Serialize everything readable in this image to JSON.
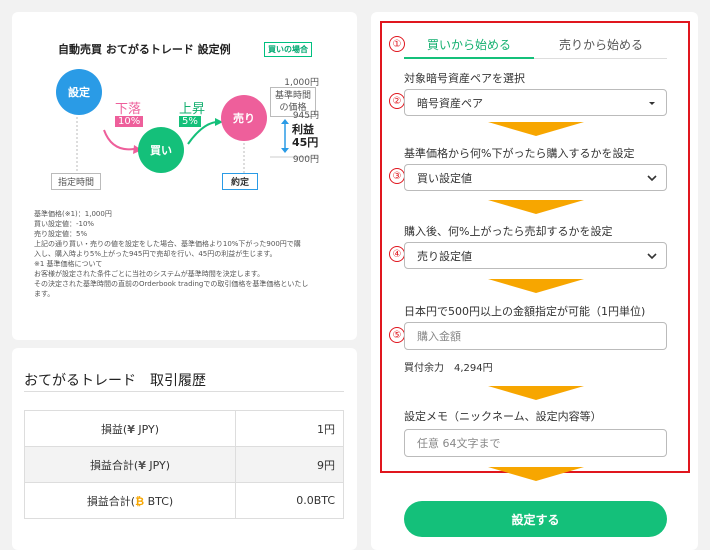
{
  "example": {
    "title": "自動売買 おてがるトレード 設定例",
    "case_badge": "買いの場合",
    "circle_set": "設定",
    "circle_buy": "買い",
    "circle_sell": "売り",
    "drop_label": "下落",
    "drop_pct": "10%",
    "rise_label": "上昇",
    "rise_pct": "5%",
    "price_1000": "1,000円",
    "ref_price_line1": "基準時間",
    "ref_price_line2": "の価格",
    "price_945": "945円",
    "profit_line1": "利益",
    "profit_line2": "45円",
    "price_900": "900円",
    "time_label": "指定時間",
    "deal_label": "約定",
    "notes": [
      "基準価格(※1)：1,000円",
      "買い設定値：-10%",
      "売り設定値：5%",
      "上記の通り買い・売りの値を設定をした場合、基準価格より10%下がった900円で購",
      "入し、購入時より5%上がった945円で売却を行い、45円の利益が生じます。",
      "※1 基準価格について",
      "お客様が設定された条件ごとに当社のシステムが基準時間を決定します。",
      "その決定された基準時間の直前のOrderbook tradingでの取引価格を基準価格といたし",
      "ます。"
    ]
  },
  "history": {
    "title": "おてがるトレード　取引履歴",
    "rows": [
      {
        "label_pre": "損益(",
        "symbol": "¥",
        "label_post": " JPY)",
        "value": "1円"
      },
      {
        "label_pre": "損益合計(",
        "symbol": "¥",
        "label_post": " JPY)",
        "value": "9円"
      },
      {
        "label_pre": "損益合計(",
        "symbol": "₿",
        "label_post": " BTC)",
        "value": "0.0BTC"
      }
    ]
  },
  "order": {
    "tabs": {
      "buy": "買いから始める",
      "sell": "売りから始める"
    },
    "markers": [
      "①",
      "②",
      "③",
      "④",
      "⑤"
    ],
    "pair_label": "対象暗号資産ペアを選択",
    "pair_value": "暗号資産ペア",
    "buy_label": "基準価格から何%下がったら購入するかを設定",
    "buy_value": "買い設定値",
    "sell_label": "購入後、何%上がったら売却するかを設定",
    "sell_value": "売り設定値",
    "amount_label": "日本円で500円以上の金額指定が可能（1円単位)",
    "amount_placeholder": "購入金額",
    "buying_power": "買付余力　4,294円",
    "memo_label": "設定メモ（ニックネーム、設定内容等）",
    "memo_placeholder": "任意 64文字まで",
    "submit": "設定する"
  },
  "colors": {
    "accent": "#14c07a",
    "pink": "#ee5f9b",
    "blue": "#2a9be6",
    "highlight": "#e0161e",
    "arrow": "#f7a600"
  }
}
